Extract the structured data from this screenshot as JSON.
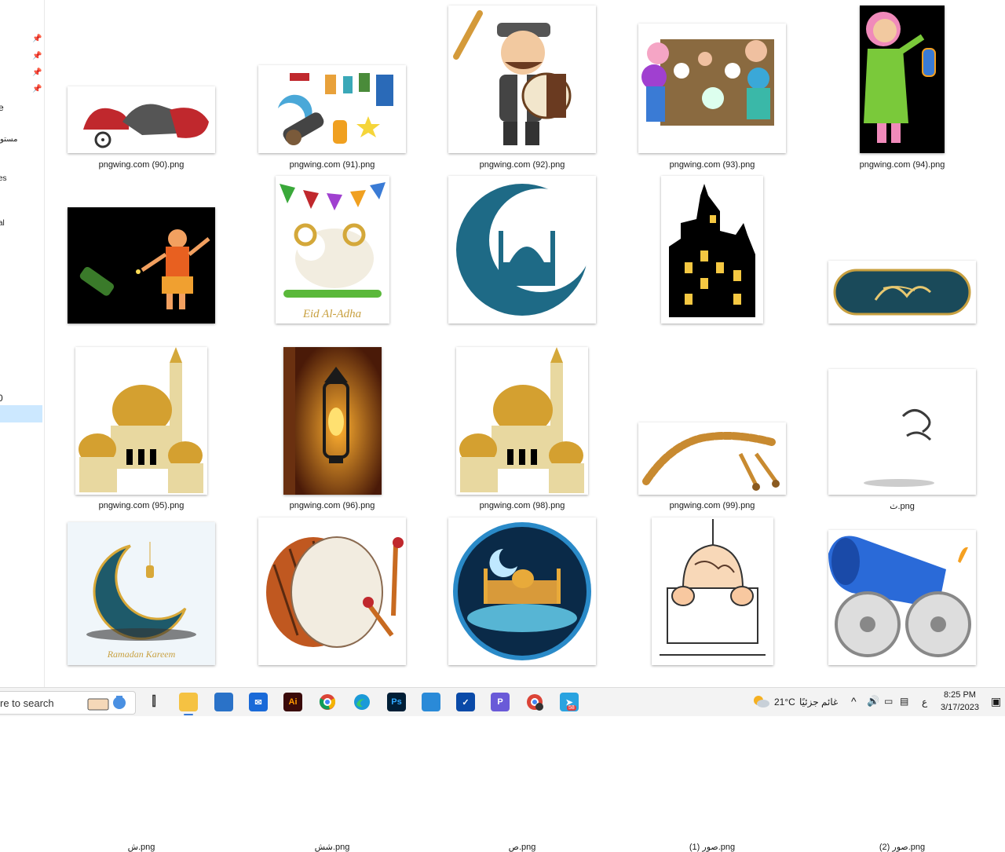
{
  "navigation": {
    "labels": [
      "e",
      "مستو",
      "es",
      "al",
      "0"
    ]
  },
  "files": [
    {
      "name": "pngwing.com (90).png"
    },
    {
      "name": "pngwing.com (91).png"
    },
    {
      "name": "pngwing.com (92).png"
    },
    {
      "name": "pngwing.com (93).png"
    },
    {
      "name": "pngwing.com (94).png"
    },
    {
      "name": "pngwing.com (95).png"
    },
    {
      "name": "pngwing.com (96).png",
      "caption": "Eid Al-Adha"
    },
    {
      "name": "pngwing.com (98).png"
    },
    {
      "name": "pngwing.com (99).png"
    },
    {
      "name": "ث.png"
    },
    {
      "name": "ش.png"
    },
    {
      "name": "شش.png"
    },
    {
      "name": "ص.png"
    },
    {
      "name": "صور (1).png"
    },
    {
      "name": "صور (2).png"
    },
    {
      "name": ""
    },
    {
      "name": ""
    },
    {
      "name": ""
    },
    {
      "name": ""
    },
    {
      "name": ""
    }
  ],
  "thumb_text": {
    "ramadan_karem": "Ramadan Kareem"
  },
  "taskbar": {
    "search_text": "re to search",
    "apps": [
      "task-view",
      "file-explorer",
      "microsoft-store",
      "mail",
      "illustrator",
      "chrome",
      "edge",
      "photoshop",
      "photos",
      "defender",
      "pdf-app",
      "chrome-profile",
      "telegram"
    ],
    "telegram_badge": "58",
    "weather_temp": "21°C",
    "weather_text": "غائم جزئيًا",
    "lang": "ع",
    "time": "8:25 PM",
    "date": "3/17/2023"
  },
  "colors": {
    "accent": "#3a7bd5",
    "selection": "#cce8ff"
  }
}
